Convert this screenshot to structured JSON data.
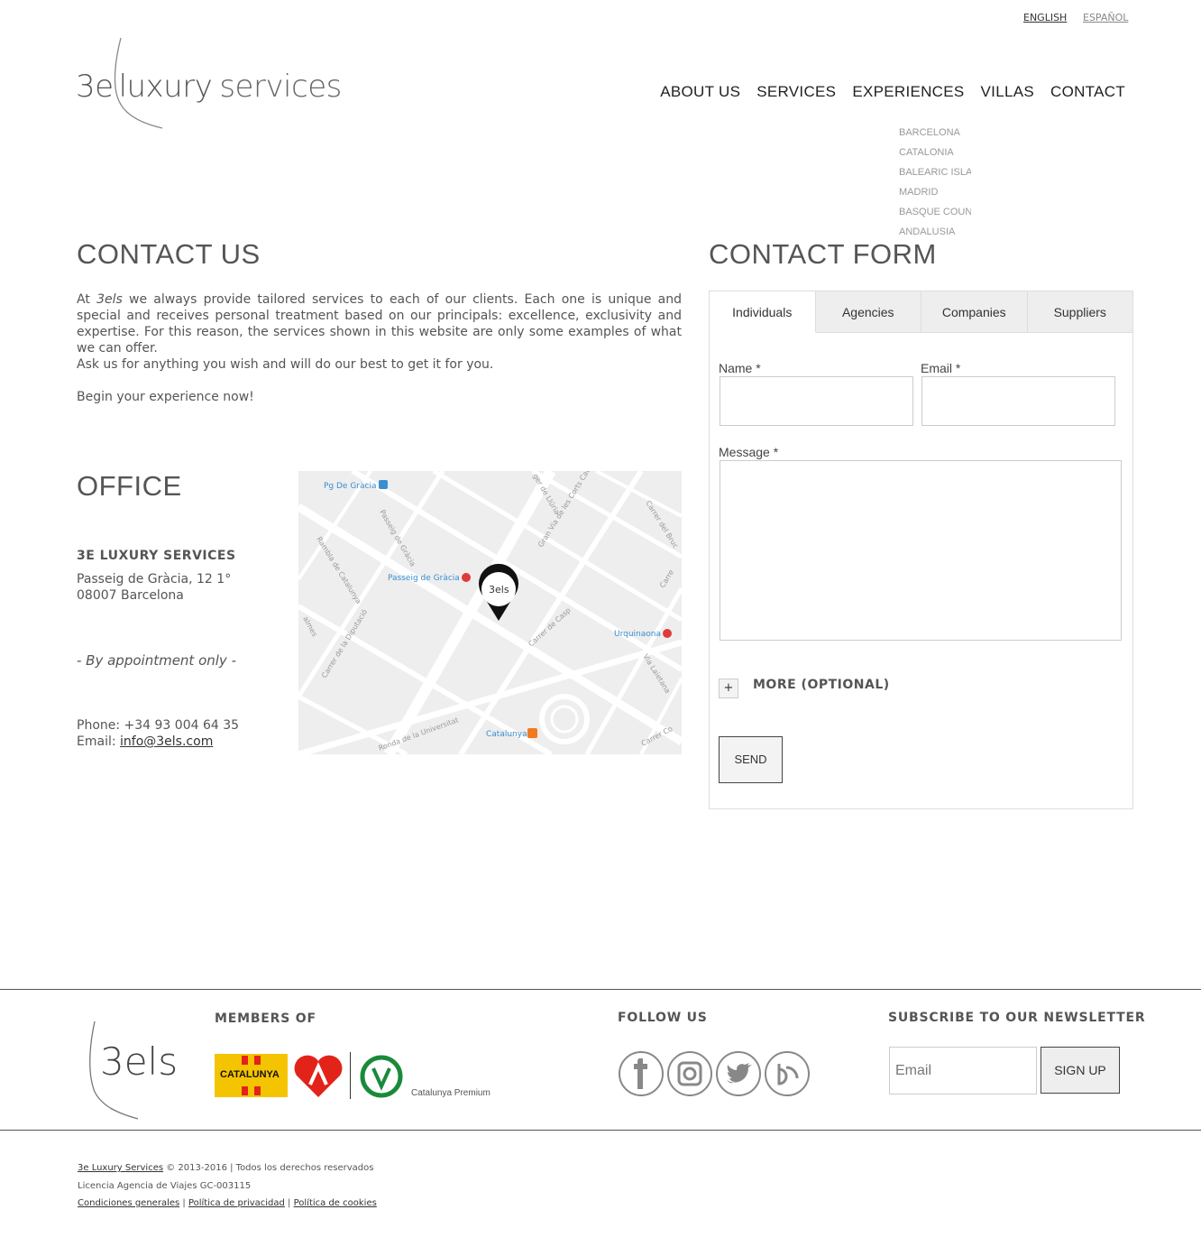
{
  "lang": {
    "english": "ENGLISH",
    "spanish": "ESPAÑOL"
  },
  "logo": {
    "text": "3e luxury services"
  },
  "nav": {
    "items": [
      "ABOUT US",
      "SERVICES",
      "EXPERIENCES",
      "VILLAS",
      "CONTACT"
    ],
    "submenu": [
      "BARCELONA",
      "CATALONIA",
      "BALEARIC ISLANDS",
      "MADRID",
      "BASQUE COUNTRY",
      "ANDALUSIA"
    ]
  },
  "contact": {
    "title": "CONTACT US",
    "para1_prefix": "At ",
    "para1_brand": "3els",
    "para1_rest": " we always provide tailored services to each of our clients. Each one is unique and special and receives personal treatment based on our principals: excellence, exclusivity and expertise. For this reason, the services shown in this website are only some examples of what we can offer.",
    "para2": "Ask us for anything you wish and will do our best to get it for you.",
    "para3": "Begin your experience now!"
  },
  "office": {
    "title": "OFFICE",
    "name": "3E LUXURY SERVICES",
    "address1": "Passeig de Gràcia, 12 1°",
    "address2": "08007 Barcelona",
    "appointment": "- By appointment only -",
    "phone": "Phone: +34 93 004 64 35",
    "email_label": "Email: ",
    "email": "info@3els.com"
  },
  "map": {
    "labels": {
      "pg_gracia": "Pg De Gràcia",
      "passeig_gracia_metro": "Passeig de Gràcia",
      "urquinaona": "Urquinaona",
      "catalunya": "Catalunya",
      "street_passeig": "Passeig de Gràcia",
      "street_rambla": "Rambla de Catalunya",
      "street_gran_via": "Gran Via de les Corts Cata",
      "street_bruc": "Carrer del Bruc",
      "street_llúria": "ger de Llúria",
      "street_casp": "Carrer de Casp",
      "street_diputacio": "Carrer de la Diputació",
      "street_laietana": "Via Laietana",
      "street_universitat": "Ronda de la Universitat",
      "street_balmes": "almes",
      "street_carrer_cor": "Carrer Co",
      "street_carre": "Carre"
    },
    "marker_text": "3els"
  },
  "form": {
    "title": "CONTACT FORM",
    "tabs": [
      "Individuals",
      "Agencies",
      "Companies",
      "Suppliers"
    ],
    "name_label": "Name *",
    "email_label": "Email *",
    "message_label": "Message *",
    "more_label": "MORE (OPTIONAL)",
    "plus": "+",
    "send": "SEND"
  },
  "footer": {
    "logo_text": "3els",
    "members_title": "MEMBERS OF",
    "members": {
      "catalunya": "CATALUNYA",
      "premium": "Catalunya Premium"
    },
    "follow_title": "FOLLOW US",
    "social": [
      "facebook-icon",
      "instagram-icon",
      "twitter-icon",
      "blog-icon"
    ],
    "newsletter_title": "SUBSCRIBE TO OUR NEWSLETTER",
    "newsletter_placeholder": "Email",
    "signup": "SIGN UP",
    "copyright_link": "3e Luxury Services",
    "copyright_rest": " © 2013-2016 | Todos los derechos reservados",
    "licence": "Licencia Agencia de Viajes GC-003115",
    "links": [
      "Condiciones generales",
      "Política de privacidad",
      "Política de cookies"
    ]
  }
}
